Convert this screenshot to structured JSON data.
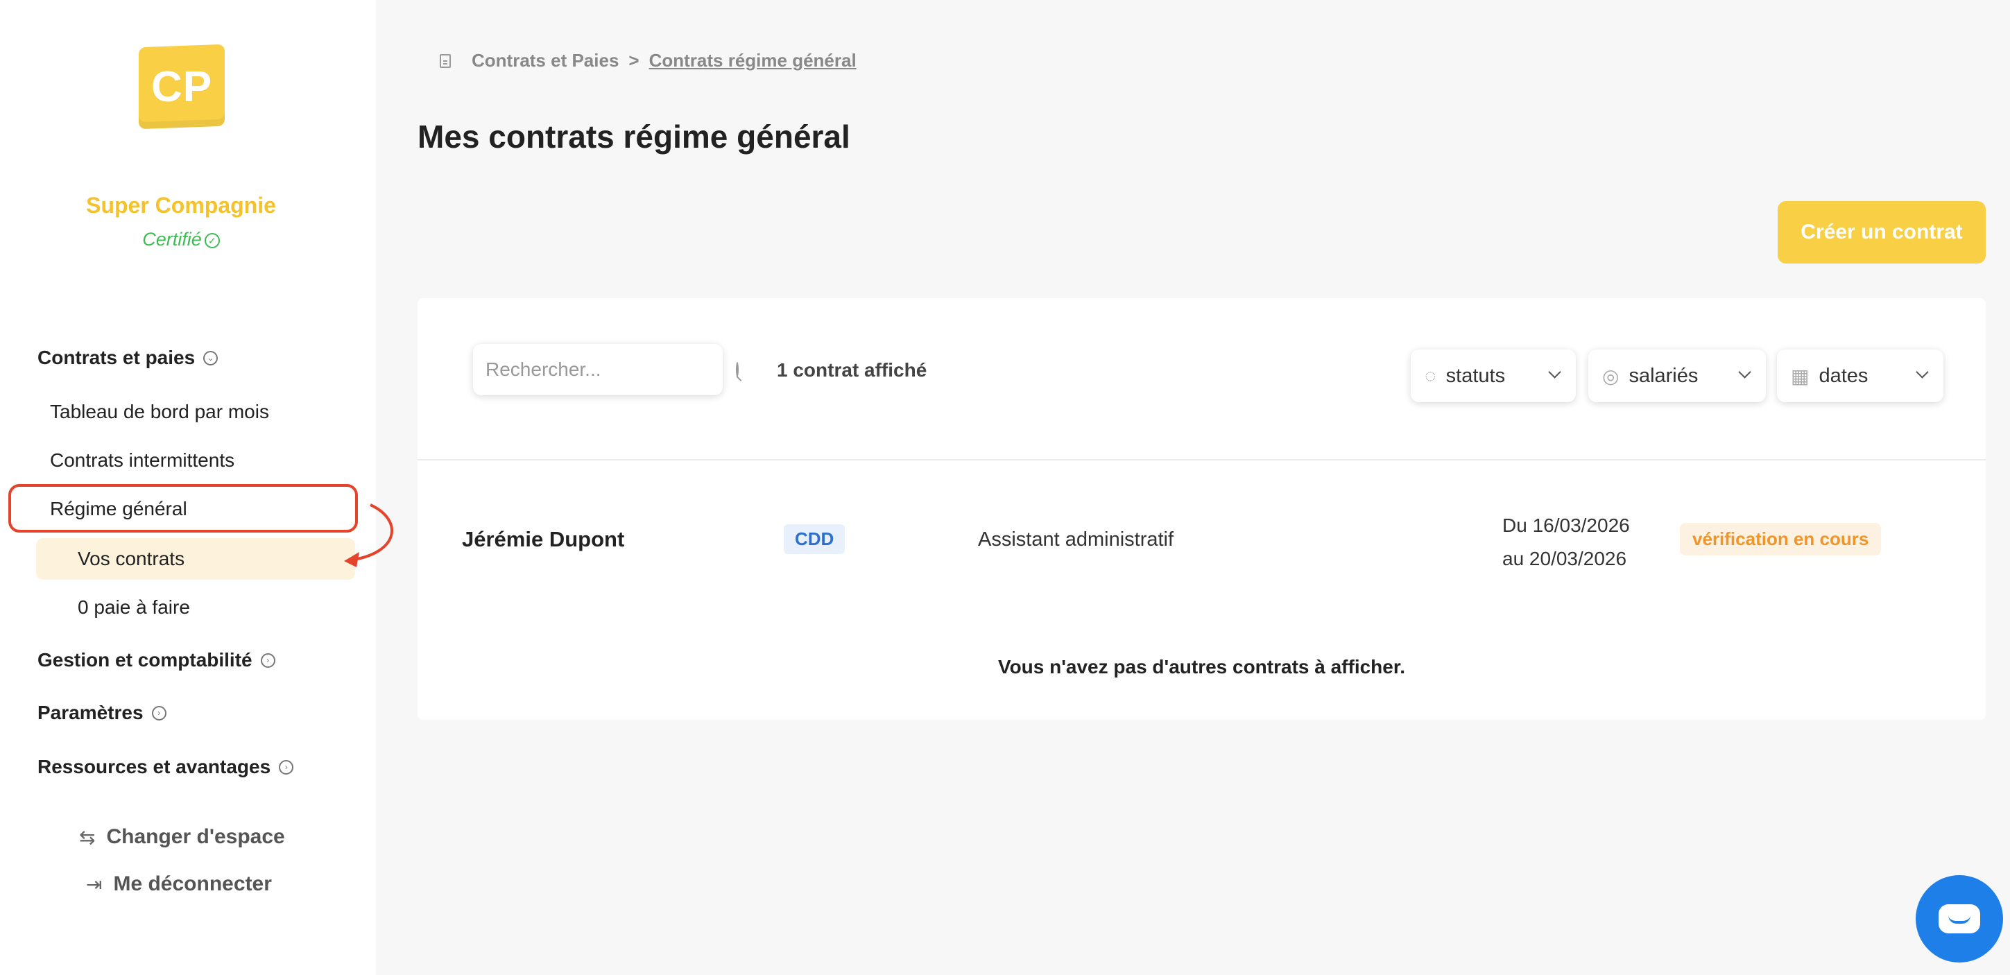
{
  "sidebar": {
    "logo_text": "CP",
    "company_name": "Super Compagnie",
    "certified_label": "Certifié",
    "sections": {
      "contracts": "Contrats et paies",
      "management": "Gestion et comptabilité",
      "settings": "Paramètres",
      "resources": "Ressources et avantages"
    },
    "items": {
      "dashboard": "Tableau de bord par mois",
      "intermittent": "Contrats intermittents",
      "general": "Régime général",
      "your_contracts": "Vos contrats",
      "payslips": "0 paie à faire"
    },
    "footer": {
      "switch_space": "Changer d'espace",
      "logout": "Me déconnecter"
    }
  },
  "breadcrumb": {
    "parent": "Contrats et Paies",
    "separator": ">",
    "current": "Contrats régime général"
  },
  "page": {
    "title": "Mes contrats régime général",
    "create_button": "Créer un contrat"
  },
  "toolbar": {
    "search_placeholder": "Rechercher...",
    "count_text": "1 contrat affiché",
    "filters": {
      "status": "statuts",
      "employees": "salariés",
      "dates": "dates"
    }
  },
  "contracts": [
    {
      "name": "Jérémie Dupont",
      "type": "CDD",
      "job": "Assistant administratif",
      "date_from": "Du 16/03/2026",
      "date_to": "au 20/03/2026",
      "status": "vérification en cours"
    }
  ],
  "empty_note": "Vous n'avez pas d'autres contrats à afficher.",
  "colors": {
    "brand_yellow": "#f8cf45",
    "certified_green": "#3fbb54",
    "highlight_red": "#e4432c",
    "badge_blue": "#2b6fd1",
    "status_orange": "#f0952a",
    "chat_blue": "#1e7fe8"
  },
  "icons": {
    "certified": "check-circle-icon",
    "section_toggle": "chevron-circle-icon",
    "switch_space": "swap-arrows-icon",
    "logout": "logout-icon",
    "search": "search-icon",
    "status_filter": "check-circle-icon",
    "employees_filter": "user-circle-icon",
    "dates_filter": "calendar-icon",
    "chat": "chat-bubble-icon"
  }
}
